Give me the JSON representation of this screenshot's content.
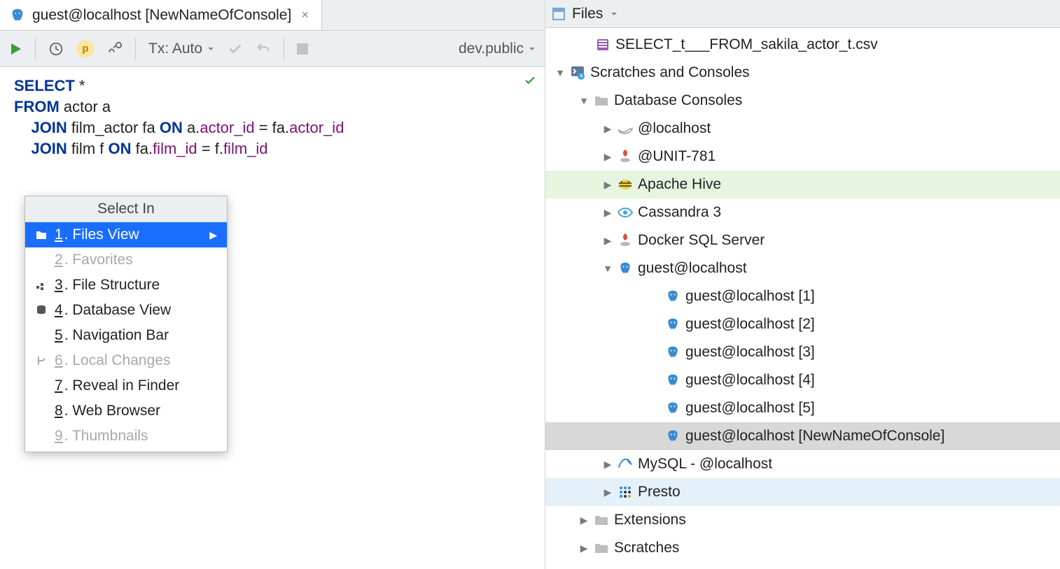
{
  "editor": {
    "tab_title": "guest@localhost [NewNameOfConsole]",
    "toolbar": {
      "tx_label": "Tx: Auto",
      "schema_label": "dev.public"
    },
    "sql": {
      "l1_kw": "SELECT",
      "l1_rest": " *",
      "l2_kw": "FROM",
      "l2_rest": " actor a",
      "l3_pre": "    ",
      "l3_kw1": "JOIN",
      "l3_mid": " film_actor fa ",
      "l3_kw2": "ON",
      "l3_a": " a.",
      "l3_col1": "actor_id",
      "l3_eq": " = fa.",
      "l3_col2": "actor_id",
      "l4_pre": "    ",
      "l4_kw1": "JOIN",
      "l4_mid": " film f ",
      "l4_kw2": "ON",
      "l4_a": " fa.",
      "l4_col1": "film_id",
      "l4_eq": " = f.",
      "l4_col2": "film_id"
    }
  },
  "popup": {
    "title": "Select In",
    "items": [
      {
        "num": "1",
        "label": "Files View",
        "icon": "folder",
        "selected": true,
        "has_sub": true,
        "disabled": false
      },
      {
        "num": "2",
        "label": "Favorites",
        "icon": "",
        "selected": false,
        "has_sub": false,
        "disabled": true
      },
      {
        "num": "3",
        "label": "File Structure",
        "icon": "struct",
        "selected": false,
        "has_sub": false,
        "disabled": false
      },
      {
        "num": "4",
        "label": "Database View",
        "icon": "db",
        "selected": false,
        "has_sub": false,
        "disabled": false
      },
      {
        "num": "5",
        "label": "Navigation Bar",
        "icon": "",
        "selected": false,
        "has_sub": false,
        "disabled": false
      },
      {
        "num": "6",
        "label": "Local Changes",
        "icon": "branch",
        "selected": false,
        "has_sub": false,
        "disabled": true
      },
      {
        "num": "7",
        "label": "Reveal in Finder",
        "icon": "",
        "selected": false,
        "has_sub": false,
        "disabled": false
      },
      {
        "num": "8",
        "label": "Web Browser",
        "icon": "",
        "selected": false,
        "has_sub": false,
        "disabled": false
      },
      {
        "num": "9",
        "label": "Thumbnails",
        "icon": "",
        "selected": false,
        "has_sub": false,
        "disabled": true
      }
    ]
  },
  "files_panel": {
    "title": "Files",
    "tree": [
      {
        "indent": 50,
        "tri": "none",
        "icon": "csv",
        "label": "SELECT_t___FROM_sakila_actor_t.csv",
        "row": ""
      },
      {
        "indent": 14,
        "tri": "open",
        "icon": "term",
        "label": "Scratches and Consoles",
        "row": ""
      },
      {
        "indent": 48,
        "tri": "open",
        "icon": "folder",
        "label": "Database Consoles",
        "row": ""
      },
      {
        "indent": 82,
        "tri": "closed",
        "icon": "whale",
        "label": "@localhost",
        "row": ""
      },
      {
        "indent": 82,
        "tri": "closed",
        "icon": "sqlsrv",
        "label": "@UNIT-781",
        "row": ""
      },
      {
        "indent": 82,
        "tri": "closed",
        "icon": "hive",
        "label": "Apache Hive",
        "row": "hl-green"
      },
      {
        "indent": 82,
        "tri": "closed",
        "icon": "eye",
        "label": "Cassandra 3",
        "row": ""
      },
      {
        "indent": 82,
        "tri": "closed",
        "icon": "sqlsrv",
        "label": "Docker SQL Server",
        "row": ""
      },
      {
        "indent": 82,
        "tri": "open",
        "icon": "pg",
        "label": "guest@localhost",
        "row": ""
      },
      {
        "indent": 150,
        "tri": "none",
        "icon": "pg",
        "label": "guest@localhost [1]",
        "row": ""
      },
      {
        "indent": 150,
        "tri": "none",
        "icon": "pg",
        "label": "guest@localhost [2]",
        "row": ""
      },
      {
        "indent": 150,
        "tri": "none",
        "icon": "pg",
        "label": "guest@localhost [3]",
        "row": ""
      },
      {
        "indent": 150,
        "tri": "none",
        "icon": "pg",
        "label": "guest@localhost [4]",
        "row": ""
      },
      {
        "indent": 150,
        "tri": "none",
        "icon": "pg",
        "label": "guest@localhost [5]",
        "row": ""
      },
      {
        "indent": 150,
        "tri": "none",
        "icon": "pg",
        "label": "guest@localhost [NewNameOfConsole]",
        "row": "sel"
      },
      {
        "indent": 82,
        "tri": "closed",
        "icon": "mysql",
        "label": "MySQL - @localhost",
        "row": ""
      },
      {
        "indent": 82,
        "tri": "closed",
        "icon": "presto",
        "label": "Presto",
        "row": "hl-blue"
      },
      {
        "indent": 48,
        "tri": "closed",
        "icon": "folder",
        "label": "Extensions",
        "row": ""
      },
      {
        "indent": 48,
        "tri": "closed",
        "icon": "folder",
        "label": "Scratches",
        "row": ""
      }
    ]
  }
}
